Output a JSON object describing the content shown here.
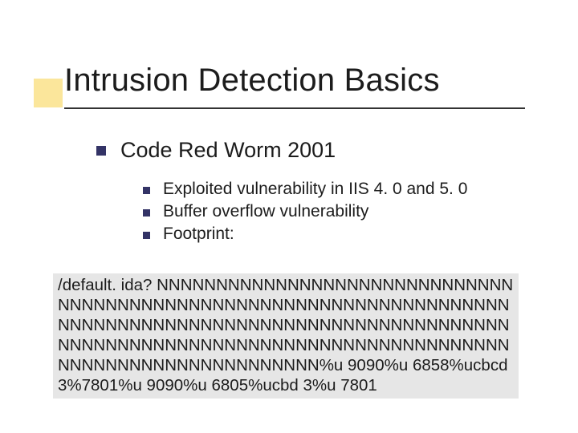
{
  "title": "Intrusion Detection Basics",
  "heading": "Code Red Worm 2001",
  "subpoints": [
    "Exploited vulnerability in IIS 4. 0 and 5. 0",
    "Buffer overflow vulnerability",
    "Footprint:"
  ],
  "footprint": "/default. ida? NNNNNNNNNNNNNNNNNNNNNNNNNNNNNNNNNNNNNNNNNNNNNNNNNNNNNNNNNNNNNNNNNNNNNNNNNNNNNNNNNNNNNNNNNNNNNNNNNNNNNNNNNNNNNNNNNNNNNNNNNNNNNNNNNNNNNNNNNNNNNNNNNNNNNNNNNNNNNNNNNNNNNN%u 9090%u 6858%ucbcd 3%7801%u 9090%u 6805%ucbd 3%u 7801"
}
